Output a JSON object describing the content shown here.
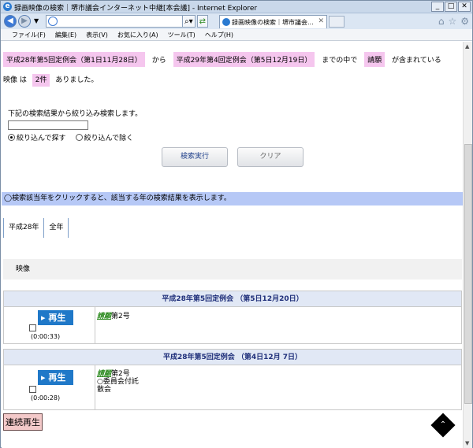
{
  "window": {
    "title": "録画映像の検索｜堺市議会インターネット中継[本会議] - Internet Explorer",
    "tab_label": "録画映像の検索｜堺市議会..."
  },
  "menu": [
    "ファイル(F)",
    "編集(E)",
    "表示(V)",
    "お気に入り(A)",
    "ツール(T)",
    "ヘルプ(H)"
  ],
  "search_summary": {
    "from_meeting": "平成28年第5回定例会（第1日11月28日）",
    "from_word": "から",
    "to_meeting": "平成29年第4回定例会（第5日12月19日）",
    "between_text": "までの中で",
    "keyword": "請願",
    "contains_text": "が含まれている",
    "video_text": "映像 は",
    "count": "2件",
    "found_text": "ありました。"
  },
  "refine": {
    "label": "下記の検索結果から絞り込み検索します。",
    "input_value": "",
    "option_include": "絞り込んで探す",
    "option_exclude": "絞り込んで除く"
  },
  "buttons": {
    "execute": "検索実行",
    "clear": "クリア",
    "continuous_play": "連続再生"
  },
  "info_bar": "◯検索該当年をクリックすると、該当する年の検索結果を表示します。",
  "years": [
    "平成28年",
    "全年"
  ],
  "section_title": "映像",
  "results": [
    {
      "title": "平成28年第5回定例会 （第5日12月20日）",
      "play": "再生",
      "duration": "(0:00:33)",
      "keyword": "請願",
      "lines": [
        "第2号"
      ]
    },
    {
      "title": "平成28年第5回定例会 （第4日12月 7日）",
      "play": "再生",
      "duration": "(0:00:28)",
      "keyword": "請願",
      "lines": [
        "第2号",
        "○委員会付託",
        "散会"
      ]
    }
  ]
}
